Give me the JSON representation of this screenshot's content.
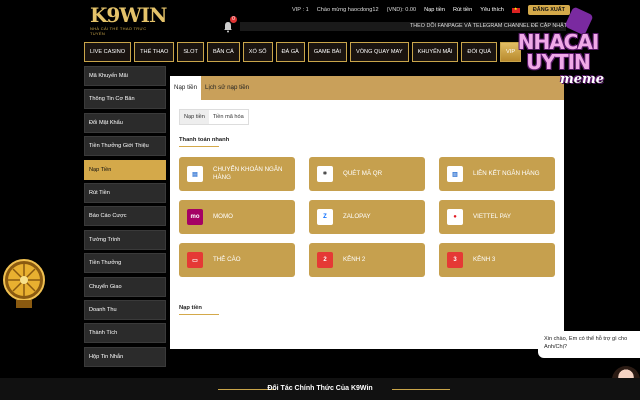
{
  "header": {
    "logo": "K9WIN",
    "logo_tagline": "NHÀ CÁI THỂ THAO TRỰC TUYẾN",
    "notification_count": "0",
    "vip_label": "VIP : 1",
    "greeting": "Chào mừng haocdong12",
    "balance": "(VND): 0.00",
    "deposit_link": "Nạp tiền",
    "withdraw_link": "Rút tiền",
    "favorite_link": "Yêu thích",
    "logout_label": "ĐĂNG XUẤT",
    "marquee_text": "THEO DÕI FANPAGE VÀ TELEGRAM CHANNEL ĐỂ CẬP NHẬT"
  },
  "nav": [
    {
      "label": "LIVE CASINO",
      "active": false
    },
    {
      "label": "THỂ THAO",
      "active": false
    },
    {
      "label": "SLOT",
      "active": false
    },
    {
      "label": "BẮN CÁ",
      "active": false
    },
    {
      "label": "XỔ SỐ",
      "active": false
    },
    {
      "label": "ĐÁ GÀ",
      "active": false
    },
    {
      "label": "GAME BÀI",
      "active": false
    },
    {
      "label": "VÒNG QUAY MAY",
      "active": false
    },
    {
      "label": "KHUYẾN MÃI",
      "active": false
    },
    {
      "label": "ĐỔI QUÀ",
      "active": false
    },
    {
      "label": "VIP",
      "active": true
    }
  ],
  "sidebar": [
    {
      "label": "Mã Khuyến Mãi",
      "active": false
    },
    {
      "label": "Thông Tin Cơ Bản",
      "active": false
    },
    {
      "label": "Đổi Mật Khẩu",
      "active": false
    },
    {
      "label": "Tiền Thưởng Giới Thiệu",
      "active": false
    },
    {
      "label": "Nạp Tiền",
      "active": true
    },
    {
      "label": "Rút Tiền",
      "active": false
    },
    {
      "label": "Báo Cáo Cược",
      "active": false
    },
    {
      "label": "Tường Trình",
      "active": false
    },
    {
      "label": "Tiền Thưởng",
      "active": false
    },
    {
      "label": "Chuyển Giao",
      "active": false
    },
    {
      "label": "Doanh Thu",
      "active": false
    },
    {
      "label": "Thành Tích",
      "active": false
    },
    {
      "label": "Hộp Tin Nhắn",
      "active": false
    }
  ],
  "panel": {
    "tabs": [
      {
        "label": "Nạp tiền",
        "active": true
      },
      {
        "label": "Lịch sử nạp tiền",
        "active": false
      }
    ],
    "subtabs": [
      {
        "label": "Nạp tiền",
        "active": true
      },
      {
        "label": "Tiền mã hóa",
        "active": false
      }
    ],
    "quick_pay_title": "Thanh toán nhanh",
    "deposit_section_title": "Nạp tiền",
    "methods": [
      {
        "label": "CHUYỂN KHOẢN NGÂN HÀNG",
        "icon": "bank-transfer-icon",
        "icon_bg": "#ffffff",
        "icon_color": "#3a7bd5",
        "glyph": "▤"
      },
      {
        "label": "QUÉT MÃ QR",
        "icon": "qr-scan-icon",
        "icon_bg": "#ffffff",
        "icon_color": "#222222",
        "glyph": "⌗"
      },
      {
        "label": "LIÊN KẾT NGÂN HÀNG",
        "icon": "bank-link-icon",
        "icon_bg": "#ffffff",
        "icon_color": "#3a7bd5",
        "glyph": "▥"
      },
      {
        "label": "MOMO",
        "icon": "momo-icon",
        "icon_bg": "#a50064",
        "icon_color": "#ffffff",
        "glyph": "mo"
      },
      {
        "label": "ZALOPAY",
        "icon": "zalopay-icon",
        "icon_bg": "#ffffff",
        "icon_color": "#0068ff",
        "glyph": "Z"
      },
      {
        "label": "VIETTEL PAY",
        "icon": "viettel-pay-icon",
        "icon_bg": "#ffffff",
        "icon_color": "#e21b23",
        "glyph": "●"
      },
      {
        "label": "THẺ CÀO",
        "icon": "scratch-card-icon",
        "icon_bg": "#e53935",
        "icon_color": "#ffffff",
        "glyph": "▭"
      },
      {
        "label": "KÊNH 2",
        "icon": "channel-2-icon",
        "icon_bg": "#e53935",
        "icon_color": "#ffffff",
        "glyph": "2"
      },
      {
        "label": "KÊNH 3",
        "icon": "channel-3-icon",
        "icon_bg": "#e53935",
        "icon_color": "#ffffff",
        "glyph": "3"
      }
    ]
  },
  "footer": {
    "title": "Đối Tác Chính Thức Của K9Win"
  },
  "chat": {
    "message": "Xin chào, Em có thể hỗ trợ gì cho Anh/Chị?"
  },
  "watermark": {
    "line1": "NHACAI",
    "line2": "UYTIN",
    "line3": "meme"
  },
  "colors": {
    "gold": "#d4a94a",
    "card": "#c6a04e",
    "sidebar": "#2b2b2b"
  }
}
